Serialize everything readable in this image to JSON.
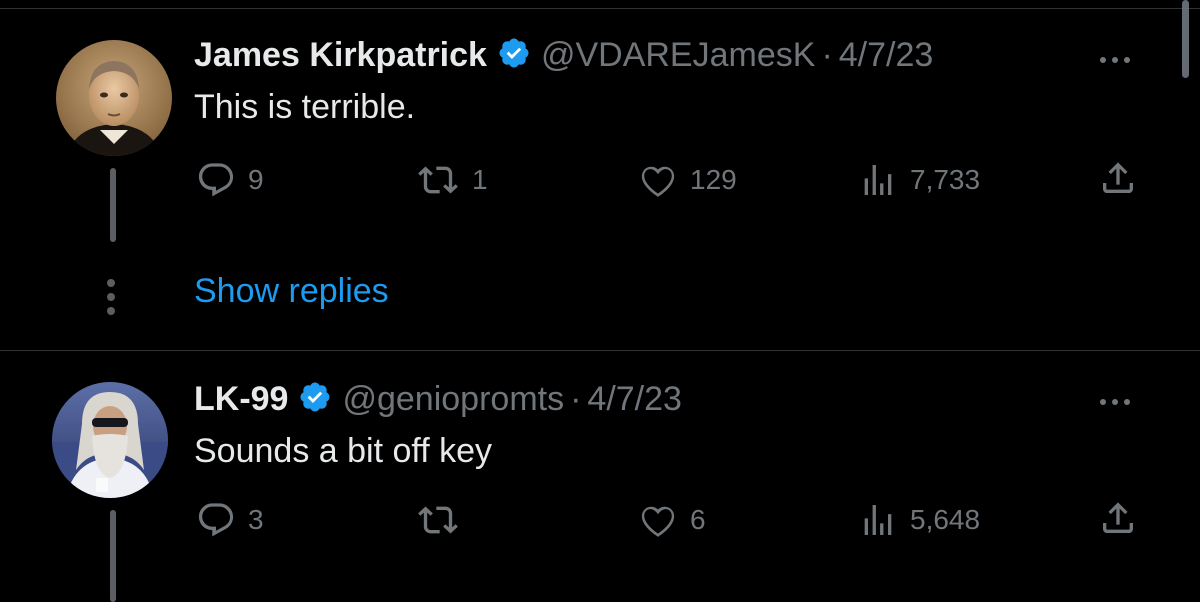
{
  "colors": {
    "background": "#000000",
    "text": "#e7e9ea",
    "muted": "#71767b",
    "accent": "#1d9bf0",
    "verified": "#1d9bf0"
  },
  "tweets": [
    {
      "name": "James Kirkpatrick",
      "handle": "@VDAREJamesK",
      "dot": "·",
      "date": "4/7/23",
      "text": "This is terrible.",
      "verified_icon": "verified-badge-icon",
      "actions": {
        "replies": "9",
        "retweets": "1",
        "likes": "129",
        "views": "7,733"
      }
    },
    {
      "name": "LK-99",
      "handle": "@geniopromts",
      "dot": "·",
      "date": "4/7/23",
      "text": "Sounds a bit off key",
      "verified_icon": "verified-badge-icon",
      "actions": {
        "replies": "3",
        "retweets": "",
        "likes": "6",
        "views": "5,648"
      }
    }
  ],
  "show_replies_label": "Show replies",
  "icons": [
    "reply-icon",
    "retweet-icon",
    "like-icon",
    "views-icon",
    "share-icon",
    "more-icon"
  ]
}
